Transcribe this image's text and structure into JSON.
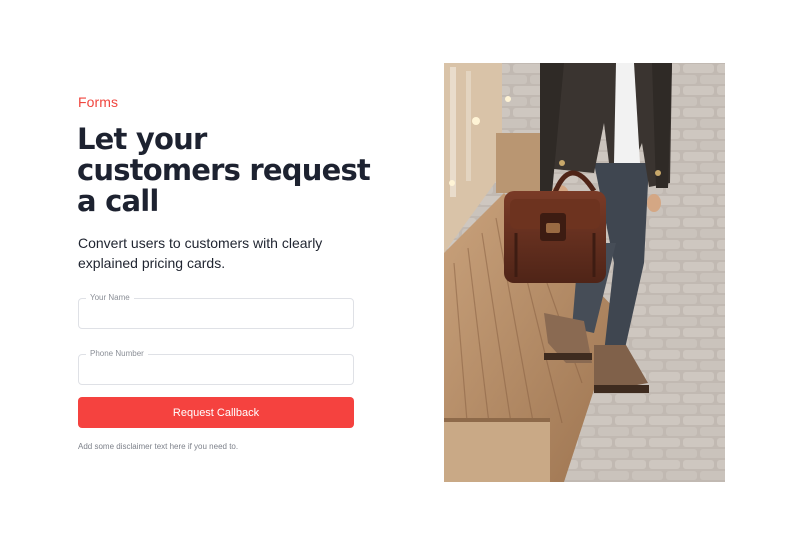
{
  "form": {
    "eyebrow": "Forms",
    "headline": "Let your customers request a call",
    "subtext": "Convert users to customers with clearly explained pricing cards.",
    "fields": [
      {
        "label": "Your Name",
        "value": ""
      },
      {
        "label": "Phone Number",
        "value": ""
      }
    ],
    "submit_label": "Request Callback",
    "disclaimer": "Add some disclaimer text here if you need to."
  },
  "colors": {
    "accent": "#f5423f",
    "heading": "#1d2230"
  }
}
